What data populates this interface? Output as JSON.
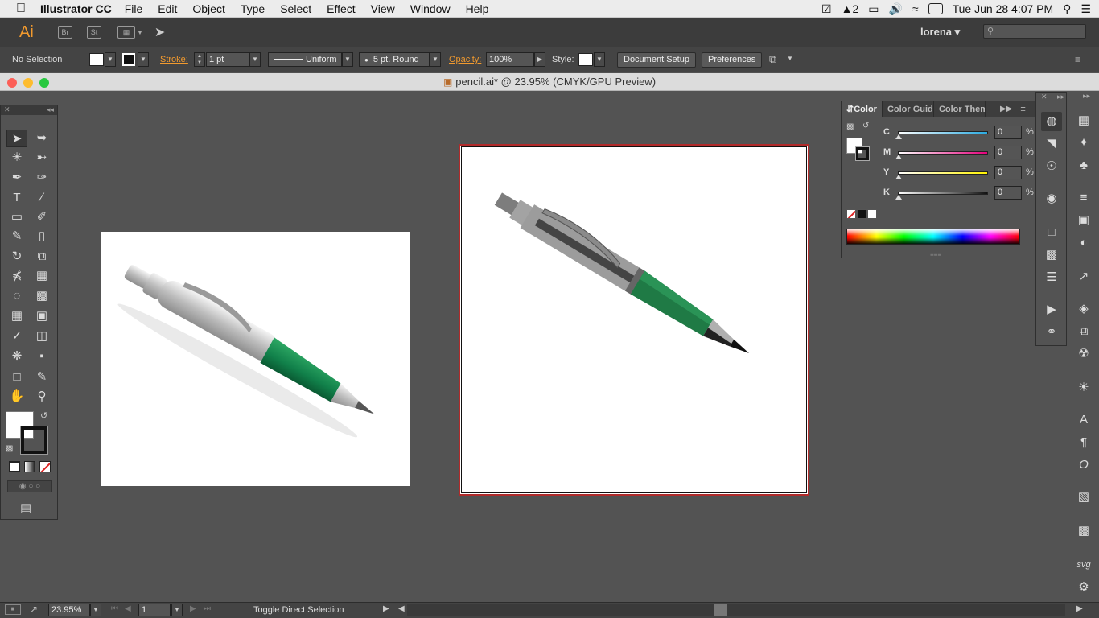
{
  "menubar": {
    "app_name": "Illustrator CC",
    "menus": [
      "File",
      "Edit",
      "Object",
      "Type",
      "Select",
      "Effect",
      "View",
      "Window",
      "Help"
    ],
    "adobe_badge": "2",
    "clock": "Tue Jun 28  4:07 PM"
  },
  "appbar": {
    "logo": "Ai",
    "bridge": "Br",
    "stock": "St",
    "user": "lorena"
  },
  "controlbar": {
    "selection": "No Selection",
    "stroke_label": "Stroke:",
    "stroke_weight": "1 pt",
    "stroke_profile": "Uniform",
    "brush": "5 pt. Round",
    "opacity_label": "Opacity:",
    "opacity": "100%",
    "style_label": "Style:",
    "doc_setup": "Document Setup",
    "preferences": "Preferences"
  },
  "window": {
    "title": "pencil.ai* @ 23.95% (CMYK/GPU Preview)"
  },
  "color_panel": {
    "tabs": [
      "Color",
      "Color Guide",
      "Color Themes"
    ],
    "channels": [
      {
        "label": "C",
        "value": "0"
      },
      {
        "label": "M",
        "value": "0"
      },
      {
        "label": "Y",
        "value": "0"
      },
      {
        "label": "K",
        "value": "0"
      }
    ],
    "unit": "%"
  },
  "statusbar": {
    "zoom": "23.95%",
    "artboard": "1",
    "status": "Toggle Direct Selection"
  },
  "colors": {
    "accent": "#f29a2e",
    "artboard_border": "#b12a2a",
    "pen_green": "#1f7a45"
  }
}
